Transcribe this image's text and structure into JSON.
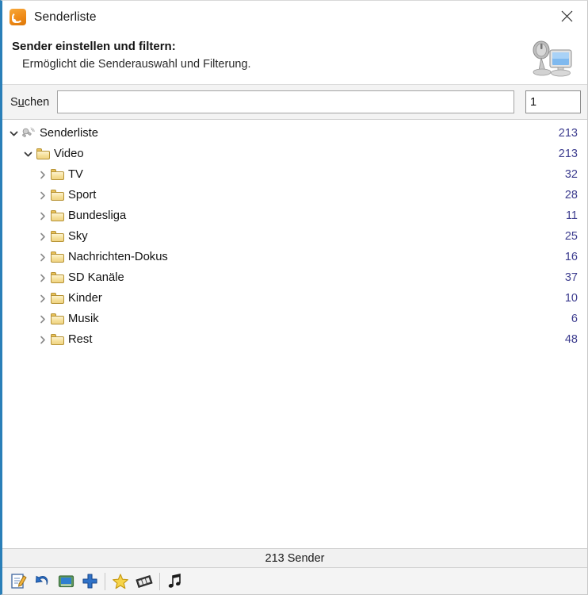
{
  "window": {
    "title": "Senderliste",
    "title_icon": "rss-signal-icon",
    "close_label": "×"
  },
  "header": {
    "title": "Sender einstellen und filtern:",
    "subtitle": "Ermöglicht die Senderauswahl und Filterung.",
    "icon": "satellite-dish-monitor-icon"
  },
  "search": {
    "label_prefix": "S",
    "label_mnemonic": "u",
    "label_suffix": "chen",
    "label_full": "Suchen",
    "value": "",
    "placeholder": "",
    "count_value": "1"
  },
  "tree": {
    "count_color": "#3d3d8f",
    "items": [
      {
        "label": "Senderliste",
        "count": "213",
        "depth": 0,
        "icon": "satellite-icon",
        "expanded": true,
        "expander": "chevron-down-icon"
      },
      {
        "label": "Video",
        "count": "213",
        "depth": 1,
        "icon": "folder-icon",
        "expanded": true,
        "expander": "chevron-down-icon"
      },
      {
        "label": "TV",
        "count": "32",
        "depth": 2,
        "icon": "folder-icon",
        "expanded": false,
        "expander": "chevron-right-icon"
      },
      {
        "label": "Sport",
        "count": "28",
        "depth": 2,
        "icon": "folder-icon",
        "expanded": false,
        "expander": "chevron-right-icon"
      },
      {
        "label": "Bundesliga",
        "count": "11",
        "depth": 2,
        "icon": "folder-icon",
        "expanded": false,
        "expander": "chevron-right-icon"
      },
      {
        "label": "Sky",
        "count": "25",
        "depth": 2,
        "icon": "folder-icon",
        "expanded": false,
        "expander": "chevron-right-icon"
      },
      {
        "label": "Nachrichten-Dokus",
        "count": "16",
        "depth": 2,
        "icon": "folder-icon",
        "expanded": false,
        "expander": "chevron-right-icon"
      },
      {
        "label": "SD Kanäle",
        "count": "37",
        "depth": 2,
        "icon": "folder-icon",
        "expanded": false,
        "expander": "chevron-right-icon"
      },
      {
        "label": "Kinder",
        "count": "10",
        "depth": 2,
        "icon": "folder-icon",
        "expanded": false,
        "expander": "chevron-right-icon"
      },
      {
        "label": "Musik",
        "count": "6",
        "depth": 2,
        "icon": "folder-icon",
        "expanded": false,
        "expander": "chevron-right-icon"
      },
      {
        "label": "Rest",
        "count": "48",
        "depth": 2,
        "icon": "folder-icon",
        "expanded": false,
        "expander": "chevron-right-icon"
      }
    ]
  },
  "status": {
    "text": "213 Sender"
  },
  "toolbar": {
    "buttons": [
      {
        "name": "edit-note-icon",
        "type": "button"
      },
      {
        "name": "undo-arrow-icon",
        "type": "button"
      },
      {
        "name": "tv-screen-icon",
        "type": "button"
      },
      {
        "name": "add-plus-icon",
        "type": "button"
      },
      {
        "name": "separator",
        "type": "separator"
      },
      {
        "name": "favorite-star-icon",
        "type": "button"
      },
      {
        "name": "film-strip-icon",
        "type": "button"
      },
      {
        "name": "separator",
        "type": "separator"
      },
      {
        "name": "music-note-icon",
        "type": "button"
      }
    ]
  }
}
